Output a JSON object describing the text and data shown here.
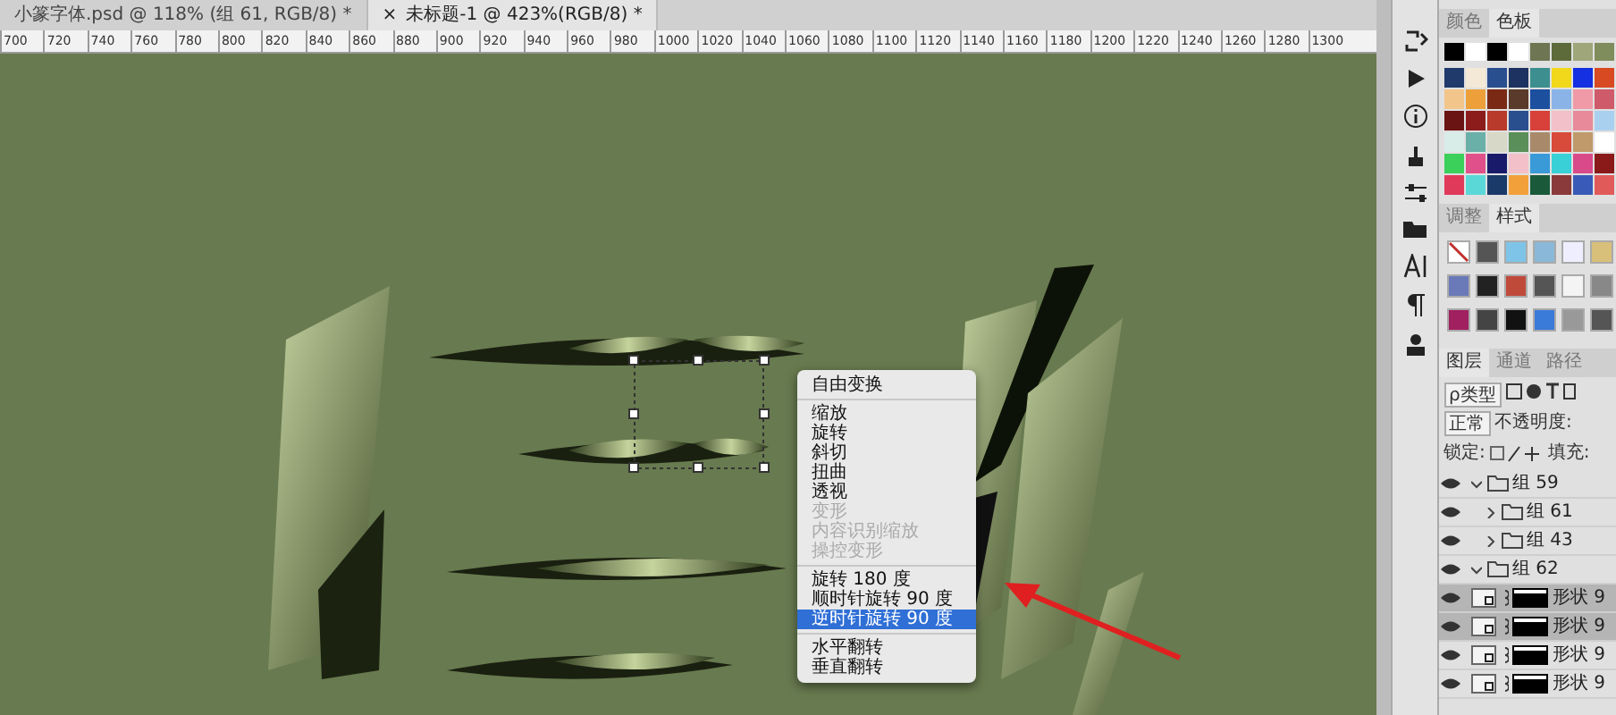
{
  "document_tabs": [
    {
      "label": "小篆字体.psd @ 118% (组 61, RGB/8) *",
      "selected": false
    },
    {
      "label": "未标题-1 @ 423%(RGB/8) *",
      "selected": true,
      "close": "×"
    }
  ],
  "ruler": {
    "labels": [
      "700",
      "720",
      "740",
      "760",
      "780",
      "800",
      "820",
      "840",
      "860",
      "880",
      "900",
      "920",
      "940",
      "960",
      "980",
      "1000",
      "1020",
      "1040",
      "1060",
      "1080",
      "1100",
      "1120",
      "1140",
      "1160",
      "1180",
      "1200",
      "1220",
      "1240",
      "1260",
      "1280",
      "1300"
    ]
  },
  "context_menu": {
    "groups": [
      [
        {
          "label": "自由变换",
          "disabled": false,
          "selected": false
        }
      ],
      [
        {
          "label": "缩放",
          "disabled": false,
          "selected": false
        },
        {
          "label": "旋转",
          "disabled": false,
          "selected": false
        },
        {
          "label": "斜切",
          "disabled": false,
          "selected": false
        },
        {
          "label": "扭曲",
          "disabled": false,
          "selected": false
        },
        {
          "label": "透视",
          "disabled": false,
          "selected": false
        },
        {
          "label": "变形",
          "disabled": true,
          "selected": false
        },
        {
          "label": "内容识别缩放",
          "disabled": true,
          "selected": false
        },
        {
          "label": "操控变形",
          "disabled": true,
          "selected": false
        }
      ],
      [
        {
          "label": "旋转 180 度",
          "disabled": false,
          "selected": false
        },
        {
          "label": "顺时针旋转 90 度",
          "disabled": false,
          "selected": false
        },
        {
          "label": "逆时针旋转 90 度",
          "disabled": false,
          "selected": true
        }
      ],
      [
        {
          "label": "水平翻转",
          "disabled": false,
          "selected": false
        },
        {
          "label": "垂直翻转",
          "disabled": false,
          "selected": false
        }
      ]
    ]
  },
  "swatches_panel": {
    "tabs": [
      {
        "label": "颜色",
        "selected": false
      },
      {
        "label": "色板",
        "selected": true
      }
    ]
  },
  "styles_panel": {
    "tabs": [
      {
        "label": "调整",
        "selected": false
      },
      {
        "label": "样式",
        "selected": true
      }
    ]
  },
  "layers_panel": {
    "tabs": [
      {
        "label": "图层",
        "selected": true
      },
      {
        "label": "通道",
        "selected": false
      },
      {
        "label": "路径",
        "selected": false
      }
    ],
    "filter": "ρ类型",
    "blend_mode": "正常",
    "opacity_label": "不透明度:",
    "lock_label": "锁定:",
    "fill_label": "填充:",
    "layers": [
      {
        "kind": "group",
        "name": "组 59",
        "visible": true,
        "expanded": true,
        "selected": false,
        "children": [
          {
            "kind": "group",
            "name": "组 61",
            "visible": true,
            "expanded": false,
            "selected": false
          },
          {
            "kind": "group",
            "name": "组 43",
            "visible": true,
            "expanded": false,
            "selected": false
          }
        ]
      },
      {
        "kind": "group",
        "name": "组 62",
        "visible": true,
        "expanded": true,
        "selected": false,
        "children": [
          {
            "kind": "shape",
            "name": "形状 9",
            "visible": true,
            "selected": true
          },
          {
            "kind": "shape",
            "name": "形状 9",
            "visible": true,
            "selected": true
          },
          {
            "kind": "shape",
            "name": "形状 9",
            "visible": true,
            "selected": false
          },
          {
            "kind": "shape",
            "name": "形状 9",
            "visible": true,
            "selected": false
          }
        ]
      }
    ]
  }
}
